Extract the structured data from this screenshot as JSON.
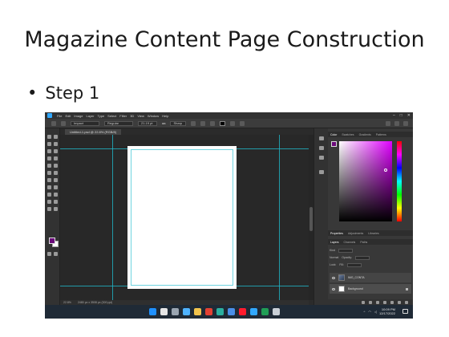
{
  "slide": {
    "title": "Magazine Content Page Construction",
    "bullet": "Step 1",
    "bullet_marker": "•"
  },
  "app": {
    "menu": [
      "File",
      "Edit",
      "Image",
      "Layer",
      "Type",
      "Select",
      "Filter",
      "3D",
      "View",
      "Window",
      "Help"
    ],
    "options_bar": {
      "font_family": "Impact",
      "font_style": "Regular",
      "font_size": "21.19 pt",
      "aa_label": "aa",
      "aa_mode": "Sharp"
    },
    "doc_tab": "Untitled-1.psd @ 22.8% (RGB/8)",
    "status": {
      "zoom": "22.8%",
      "doc_size": "2480 px x 3508 px (300 ppi)"
    },
    "panel_tabs_top": [
      "Color",
      "Swatches",
      "Gradients",
      "Patterns"
    ],
    "panel_tabs_mid": [
      "Properties",
      "Adjustments",
      "Libraries"
    ],
    "panel_tabs_layers": [
      "Layers",
      "Channels",
      "Paths"
    ],
    "layers_controls": {
      "kind": "Kind",
      "mode": "Normal",
      "opacity_label": "Opacity:",
      "lock_label": "Lock:",
      "fill_label": "Fill:"
    },
    "layers": [
      {
        "name": "IMG_CONTA",
        "selected": false
      },
      {
        "name": "Background",
        "selected": true
      }
    ],
    "colors": {
      "foreground": "#6b0a7a",
      "accent": "#1fb7c8"
    }
  },
  "taskbar": {
    "time": "10:09 PM",
    "date": "12/17/2022",
    "tray": [
      "^",
      "wifi",
      "vol"
    ],
    "icons": [
      {
        "name": "windows-start-icon",
        "color": "#1e90ff"
      },
      {
        "name": "search-icon",
        "color": "#e6e6e6"
      },
      {
        "name": "task-view-icon",
        "color": "#9aa5b1"
      },
      {
        "name": "widgets-icon",
        "color": "#4fb3ff"
      },
      {
        "name": "file-explorer-icon",
        "color": "#f2c44d"
      },
      {
        "name": "chrome-icon",
        "color": "#e34133"
      },
      {
        "name": "edge-icon",
        "color": "#2bb0a0"
      },
      {
        "name": "store-icon",
        "color": "#4a8fe8"
      },
      {
        "name": "opera-icon",
        "color": "#ff1b2d"
      },
      {
        "name": "photoshop-icon",
        "color": "#31a8ff"
      },
      {
        "name": "excel-icon",
        "color": "#1f9d55"
      },
      {
        "name": "app-icon",
        "color": "#c9cfd6"
      }
    ]
  }
}
